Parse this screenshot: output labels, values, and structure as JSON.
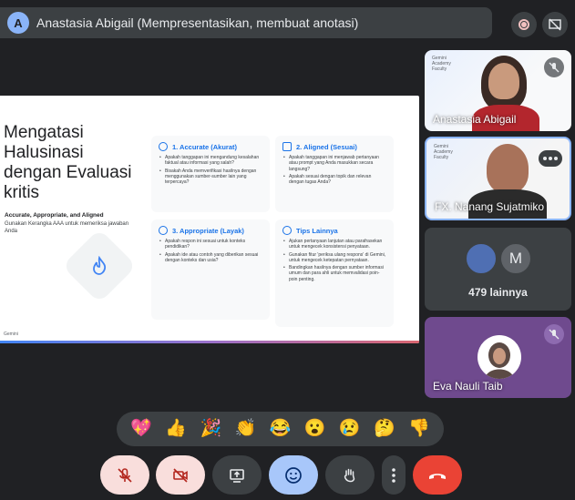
{
  "presenter_bar": {
    "avatar_letter": "A",
    "text": "Anastasia Abigail (Mempresentasikan, membuat anotasi)"
  },
  "slide": {
    "title": "Mengatasi Halusinasi dengan Evaluasi kritis",
    "subtitle_bold": "Accurate, Appropriate, and Aligned",
    "subtitle": "Gunakan Kerangka AAA untuk memeriksa jawaban Anda",
    "footer": "Gemini",
    "cards": [
      {
        "heading": "1. Accurate (Akurat)",
        "items": [
          "Apakah tanggapan ini mengandung kesalahan faktual atau informasi yang salah?",
          "Bisakah Anda memverifikasi hasilnya dengan menggunakan sumber-sumber lain yang terpercaya?"
        ]
      },
      {
        "heading": "2. Aligned (Sesuai)",
        "items": [
          "Apakah tanggapan ini menjawab pertanyaan atau prompt yang Anda masukkan secara langsung?",
          "Apakah sesuai dengan topik dan relevan dengan tugas Anda?"
        ]
      },
      {
        "heading": "3. Appropriate (Layak)",
        "items": [
          "Apakah respon ini sesuai untuk konteks pendidikan?",
          "Apakah ide atau contoh yang diberikan sesuai dengan konteks dan usia?"
        ]
      },
      {
        "heading": "Tips Lainnya",
        "items": [
          "Ajukan pertanyaan lanjutan atau parafrasekan untuk mengecek konsistensi penyataan.",
          "Gunakan fitur 'periksa ulang respons' di Gemini, untuk mengecek ketepatan pernyataan.",
          "Bandingkan hasilnya dengan sumber informasi umum dan para ahli untuk memvalidasi poin-poin penting."
        ]
      }
    ]
  },
  "tiles": {
    "tile1_name": "Anastasia Abigail",
    "tile1_brand": "Gemini Academy Faculty",
    "tile2_name": "FX. Nanang Sujatmiko",
    "tile2_brand": "Gemini Academy Faculty",
    "tile3_avatar_letter": "M",
    "tile3_count": "479 lainnya",
    "tile4_name": "Eva Nauli Taib"
  },
  "reactions": [
    "💖",
    "👍",
    "🎉",
    "👏",
    "😂",
    "😮",
    "😢",
    "🤔",
    "👎"
  ],
  "colors": {
    "background": "#202124",
    "tile_purple": "#6f4a8e",
    "end_call": "#ea4335",
    "emoji_active": "#a8c7fa",
    "muted_soft": "#f9dedc"
  }
}
